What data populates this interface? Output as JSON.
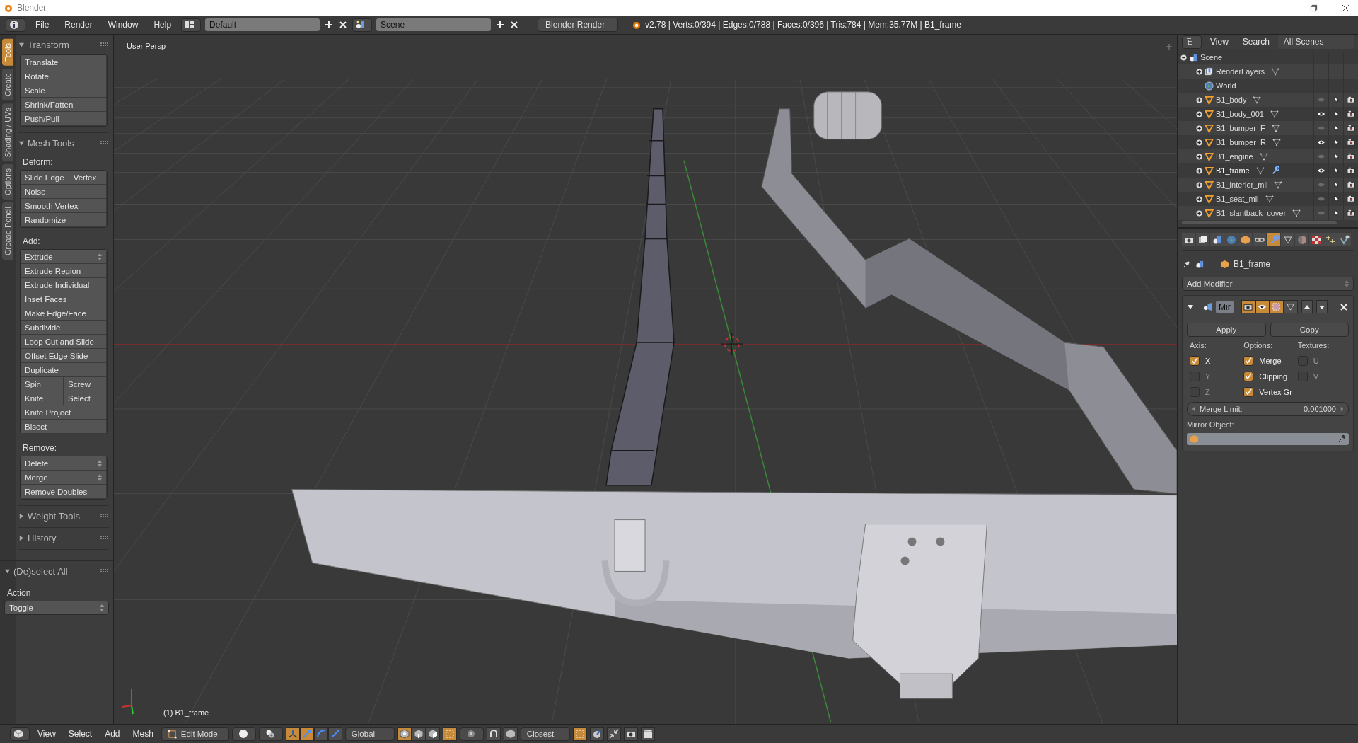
{
  "window": {
    "title": "Blender"
  },
  "info_header": {
    "menus": [
      "File",
      "Render",
      "Window",
      "Help"
    ],
    "layout": "Default",
    "scene": "Scene",
    "engine": "Blender Render",
    "stats": "v2.78 | Verts:0/394 | Edges:0/788 | Faces:0/396 | Tris:784 | Mem:35.77M | B1_frame"
  },
  "tool_tabs": [
    {
      "label": "Tools",
      "selected": true
    },
    {
      "label": "Create",
      "selected": false
    },
    {
      "label": "Shading / UVs",
      "selected": false
    },
    {
      "label": "Options",
      "selected": false
    },
    {
      "label": "Grease Pencil",
      "selected": false
    }
  ],
  "tool_panels": [
    {
      "title": "Transform",
      "expanded": true,
      "sections": [
        {
          "rows": [
            {
              "kind": "button",
              "items": [
                "Translate"
              ]
            },
            {
              "kind": "button",
              "items": [
                "Rotate"
              ]
            },
            {
              "kind": "button",
              "items": [
                "Scale"
              ]
            },
            {
              "kind": "button",
              "items": [
                "Shrink/Fatten"
              ]
            },
            {
              "kind": "button",
              "items": [
                "Push/Pull"
              ]
            }
          ]
        }
      ]
    },
    {
      "title": "Mesh Tools",
      "expanded": true,
      "sections": [
        {
          "heading": "Deform:",
          "rows": [
            {
              "kind": "button",
              "items": [
                "Slide Edge",
                "Vertex"
              ]
            },
            {
              "kind": "button",
              "items": [
                "Noise"
              ]
            },
            {
              "kind": "button",
              "items": [
                "Smooth Vertex"
              ]
            },
            {
              "kind": "button",
              "items": [
                "Randomize"
              ]
            }
          ]
        },
        {
          "heading": "Add:",
          "rows": [
            {
              "kind": "dropdown",
              "items": [
                "Extrude"
              ]
            },
            {
              "kind": "button",
              "items": [
                "Extrude Region"
              ]
            },
            {
              "kind": "button",
              "items": [
                "Extrude Individual"
              ]
            },
            {
              "kind": "button",
              "items": [
                "Inset Faces"
              ]
            },
            {
              "kind": "button",
              "items": [
                "Make Edge/Face"
              ]
            },
            {
              "kind": "button",
              "items": [
                "Subdivide"
              ]
            },
            {
              "kind": "button",
              "items": [
                "Loop Cut and Slide"
              ]
            },
            {
              "kind": "button",
              "items": [
                "Offset Edge Slide"
              ]
            },
            {
              "kind": "button",
              "items": [
                "Duplicate"
              ]
            },
            {
              "kind": "button",
              "items": [
                "Spin",
                "Screw"
              ]
            },
            {
              "kind": "button",
              "items": [
                "Knife",
                "Select"
              ]
            },
            {
              "kind": "button",
              "items": [
                "Knife Project"
              ]
            },
            {
              "kind": "button",
              "items": [
                "Bisect"
              ]
            }
          ]
        },
        {
          "heading": "Remove:",
          "rows": [
            {
              "kind": "dropdown",
              "items": [
                "Delete"
              ]
            },
            {
              "kind": "dropdown",
              "items": [
                "Merge"
              ]
            },
            {
              "kind": "button",
              "items": [
                "Remove Doubles"
              ]
            }
          ]
        }
      ]
    },
    {
      "title": "Weight Tools",
      "expanded": false
    },
    {
      "title": "History",
      "expanded": false
    }
  ],
  "operator_panel": {
    "title": "(De)select All",
    "expanded": true,
    "label": "Action",
    "value": "Toggle"
  },
  "viewport": {
    "view_label": "User Persp",
    "object_label": "(1) B1_frame"
  },
  "outliner": {
    "menus": [
      "View",
      "Search"
    ],
    "filter": "All Scenes",
    "items": [
      {
        "name": "Scene",
        "kind": "scene",
        "expanded": true,
        "selected": false,
        "children": [
          {
            "name": "RenderLayers",
            "kind": "renderlayers",
            "expanded": false,
            "selected": false
          },
          {
            "name": "World",
            "kind": "world",
            "selected": false
          },
          {
            "name": "B1_body",
            "kind": "mesh",
            "expanded": false,
            "selected": false,
            "visible": false,
            "modifier": false
          },
          {
            "name": "B1_body_001",
            "kind": "mesh",
            "expanded": false,
            "selected": false,
            "visible": true,
            "modifier": false
          },
          {
            "name": "B1_bumper_F",
            "kind": "mesh",
            "expanded": false,
            "selected": false,
            "visible": false,
            "modifier": false
          },
          {
            "name": "B1_bumper_R",
            "kind": "mesh",
            "expanded": false,
            "selected": false,
            "visible": true,
            "modifier": false
          },
          {
            "name": "B1_engine",
            "kind": "mesh",
            "expanded": false,
            "selected": false,
            "visible": false,
            "modifier": false
          },
          {
            "name": "B1_frame",
            "kind": "mesh",
            "expanded": false,
            "selected": true,
            "visible": true,
            "modifier": true
          },
          {
            "name": "B1_interior_mil",
            "kind": "mesh",
            "expanded": false,
            "selected": false,
            "visible": false,
            "modifier": false
          },
          {
            "name": "B1_seat_mil",
            "kind": "mesh",
            "expanded": false,
            "selected": false,
            "visible": false,
            "modifier": false
          },
          {
            "name": "B1_slantback_cover",
            "kind": "mesh",
            "expanded": false,
            "selected": false,
            "visible": false,
            "modifier": false
          }
        ]
      }
    ]
  },
  "properties": {
    "tabs": [
      {
        "kind": "render",
        "selected": false
      },
      {
        "kind": "layers",
        "selected": false
      },
      {
        "kind": "scene",
        "selected": false
      },
      {
        "kind": "world",
        "selected": false
      },
      {
        "kind": "object",
        "selected": false
      },
      {
        "kind": "constraints",
        "selected": false
      },
      {
        "kind": "modifiers",
        "selected": true
      },
      {
        "kind": "data",
        "selected": false
      },
      {
        "kind": "material",
        "selected": false
      },
      {
        "kind": "texture",
        "selected": false
      },
      {
        "kind": "particles",
        "selected": false
      },
      {
        "kind": "physics",
        "selected": false
      }
    ],
    "object": "B1_frame",
    "add_modifier": "Add Modifier",
    "modifier": {
      "name": "Mir",
      "expanded": true,
      "toggles": [
        {
          "kind": "render",
          "on": true
        },
        {
          "kind": "viewport",
          "on": true
        },
        {
          "kind": "editmode",
          "on": true
        },
        {
          "kind": "cage",
          "on": false
        }
      ],
      "apply": "Apply",
      "copy": "Copy",
      "columns": [
        {
          "heading": "Axis:",
          "options": [
            {
              "label": "X",
              "checked": true
            },
            {
              "label": "Y",
              "checked": false
            },
            {
              "label": "Z",
              "checked": false
            }
          ]
        },
        {
          "heading": "Options:",
          "options": [
            {
              "label": "Merge",
              "checked": true
            },
            {
              "label": "Clipping",
              "checked": true
            },
            {
              "label": "Vertex Gr",
              "checked": true
            }
          ]
        },
        {
          "heading": "Textures:",
          "options": [
            {
              "label": "U",
              "checked": false
            },
            {
              "label": "V",
              "checked": false
            }
          ]
        }
      ],
      "merge_limit": {
        "label": "Merge Limit:",
        "value": "0.001000"
      },
      "mirror_object_label": "Mirror Object:"
    }
  },
  "view3d_header": {
    "menus": [
      "View",
      "Select",
      "Add",
      "Mesh"
    ],
    "mode": "Edit Mode",
    "manipulators": [
      {
        "kind": "axes",
        "on": true
      },
      {
        "kind": "translate",
        "on": true
      },
      {
        "kind": "rotate",
        "on": false
      },
      {
        "kind": "scale",
        "on": false
      }
    ],
    "orientation": "Global",
    "select_modes": [
      {
        "kind": "vertex",
        "selected": true
      },
      {
        "kind": "edge",
        "selected": false
      },
      {
        "kind": "face",
        "selected": false
      }
    ],
    "snap_target": "Closest"
  }
}
